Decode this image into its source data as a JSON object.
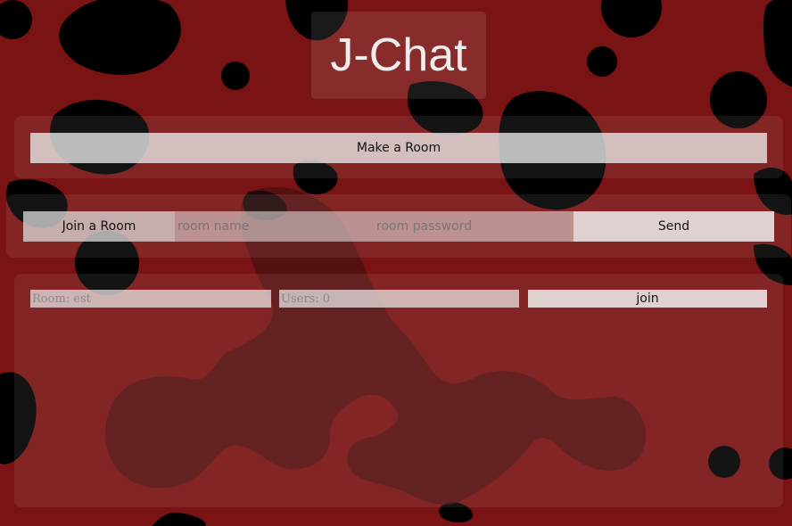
{
  "app": {
    "title": "J-Chat"
  },
  "make_room": {
    "button_label": "Make a Room"
  },
  "join_room": {
    "label": "Join a Room",
    "room_name_placeholder": "room name",
    "room_password_placeholder": "room password",
    "send_label": "Send"
  },
  "room_list": {
    "rooms": [
      {
        "room_label": "Room:  est",
        "users_label": "Users: 0",
        "join_label": "join"
      }
    ]
  },
  "colors": {
    "background": "#7a1313",
    "blob": "#000000",
    "title_text": "#f1eded"
  }
}
